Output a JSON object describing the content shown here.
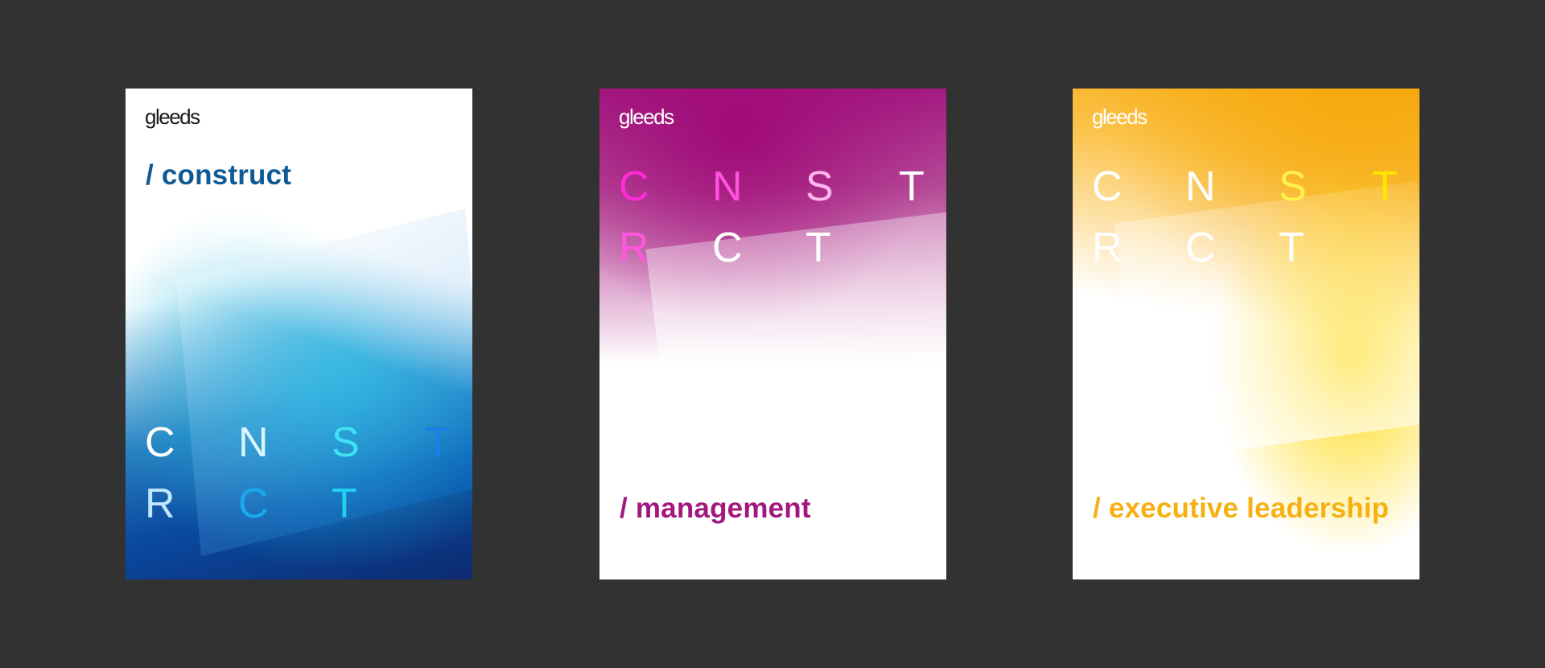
{
  "cards": [
    {
      "logo": "gleeds",
      "heading": "/ construct",
      "letters": [
        "C",
        "N",
        "S",
        "T",
        "R",
        "C",
        "T"
      ],
      "letter_colors": [
        "#ffffff",
        "#d8f6ff",
        "#3fe0f0",
        "#1b7fe8",
        "#bfe8ff",
        "#1aa8ee",
        "#1fd2f2"
      ],
      "accent": "#0e5a95"
    },
    {
      "logo": "gleeds",
      "heading": "/ management",
      "letters": [
        "C",
        "N",
        "S",
        "T",
        "R",
        "C",
        "T"
      ],
      "letter_colors": [
        "#ff2bd8",
        "#ff52e0",
        "#ffb8ee",
        "#ffffff",
        "#ff58dc",
        "#ffffff",
        "#ffffff"
      ],
      "accent": "#a3187f"
    },
    {
      "logo": "gleeds",
      "heading": "/ executive leadership",
      "letters": [
        "C",
        "N",
        "S",
        "T",
        "R",
        "C",
        "T"
      ],
      "letter_colors": [
        "#ffffff",
        "#ffffff",
        "#fff24a",
        "#ffe600",
        "#ffffff",
        "#ffffff",
        "#ffffff"
      ],
      "accent": "#f6b012"
    }
  ]
}
